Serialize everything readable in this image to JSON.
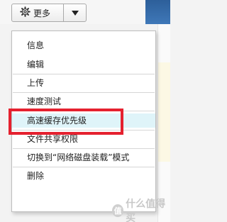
{
  "toolbar": {
    "more_label": "更多",
    "gear_icon": "gear-icon",
    "caret_icon": "caret-down-icon"
  },
  "menu": {
    "items": [
      {
        "label": "信息"
      },
      {
        "label": "编辑"
      },
      {
        "label": "上传"
      },
      {
        "label": "速度测试"
      },
      {
        "label": "高速缓存优先级"
      },
      {
        "label": "文件共享权限"
      },
      {
        "label": "切换到“网络磁盘装载”模式"
      },
      {
        "label": "删除"
      }
    ],
    "highlight_color": "#dff4f9",
    "callout_color": "#e5212f"
  },
  "watermark": {
    "logo_char": "值",
    "text": "什么值得买"
  }
}
